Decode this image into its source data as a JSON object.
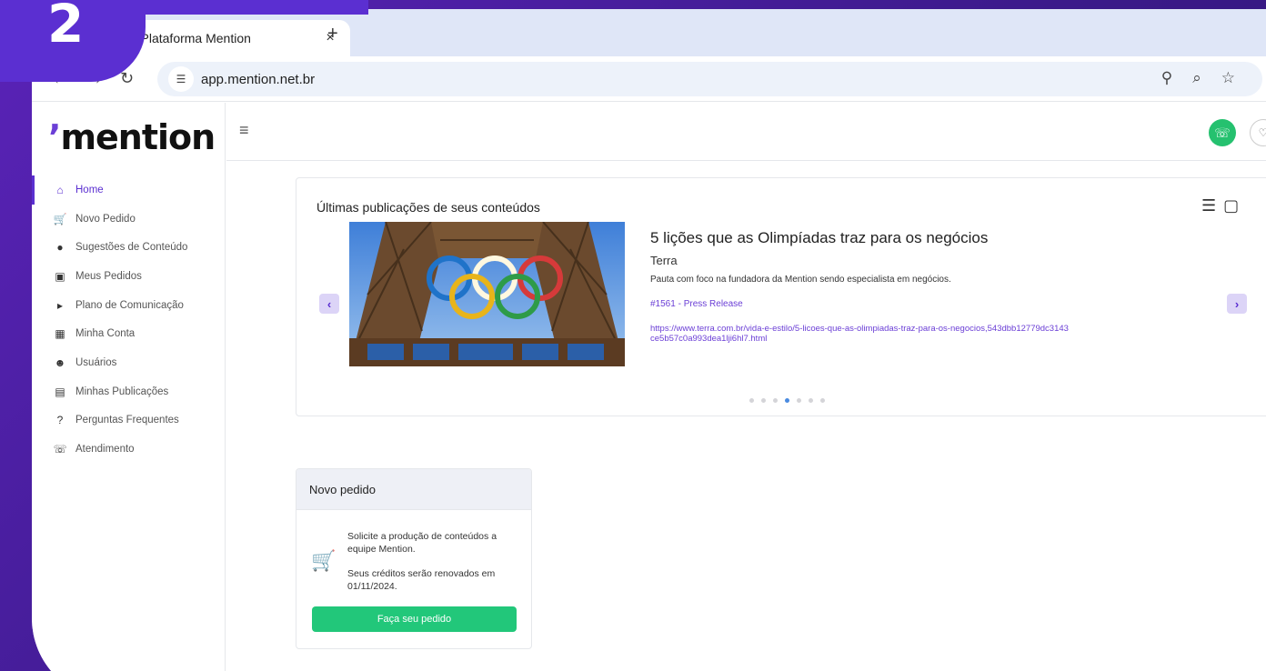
{
  "step_badge": "2",
  "browser": {
    "tab_title": "| Plataforma Mention",
    "tab_close": "×",
    "new_tab": "+",
    "url": "app.mention.net.br"
  },
  "app": {
    "logo_text": "mention",
    "sidebar": {
      "items": [
        {
          "label": "Home",
          "icon": "home-icon",
          "active": true
        },
        {
          "label": "Novo Pedido",
          "icon": "cart-icon"
        },
        {
          "label": "Sugestões de Conteúdo",
          "icon": "lightbulb-icon"
        },
        {
          "label": "Meus Pedidos",
          "icon": "briefcase-icon"
        },
        {
          "label": "Plano de Comunicação",
          "icon": "megaphone-icon"
        },
        {
          "label": "Minha Conta",
          "icon": "building-icon"
        },
        {
          "label": "Usuários",
          "icon": "users-icon"
        },
        {
          "label": "Minhas Publicações",
          "icon": "newspaper-icon"
        },
        {
          "label": "Perguntas Frequentes",
          "icon": "question-icon"
        },
        {
          "label": "Atendimento",
          "icon": "whatsapp-icon"
        }
      ]
    },
    "publications": {
      "title": "Últimas publicações de seus conteúdos",
      "headline": "5 lições que as Olimpíadas traz para os negócios",
      "source": "Terra",
      "description": "Pauta com foco na fundadora da Mention sendo especialista em negócios.",
      "tag": "#1561 - Press Release",
      "link": "https://www.terra.com.br/vida-e-estilo/5-licoes-que-as-olimpiadas-traz-para-os-negocios,543dbb12779dc3143ce5b57c0a993dea1lji6hl7.html",
      "dot_count": 7,
      "active_dot": 3
    },
    "new_order": {
      "title": "Novo pedido",
      "text1": "Solicite a produção de conteúdos a equipe Mention.",
      "text2": "Seus créditos serão renovados em 01/11/2024.",
      "button": "Faça seu pedido"
    }
  },
  "colors": {
    "brand": "#5b2fd1",
    "success": "#22c77a",
    "link": "#6b3fd6"
  }
}
